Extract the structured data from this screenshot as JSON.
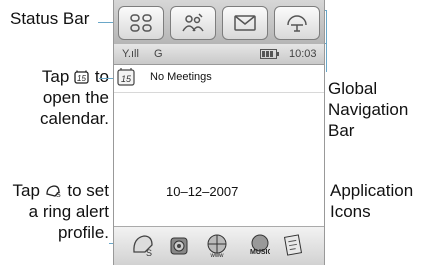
{
  "callouts": {
    "status_bar": "Status Bar",
    "calendar_hint": [
      "Tap",
      "to",
      "open the",
      "calendar."
    ],
    "global_nav": [
      "Global",
      "Navigation",
      "Bar"
    ],
    "ring_hint": [
      "Tap",
      "to set",
      "a ring alert",
      "profile."
    ],
    "app_icons": [
      "Application",
      "Icons"
    ]
  },
  "phone": {
    "nav_buttons": [
      "menu-icon",
      "contacts-icon",
      "message-icon",
      "browser-icon"
    ],
    "status": {
      "signal": "Y.ıll",
      "network": "G",
      "time": "10:03"
    },
    "meetings_text": "No Meetings",
    "date": "10–12–2007",
    "app_icons": [
      "ring-alert-icon",
      "camera-icon",
      "www-icon",
      "music-icon",
      "notes-icon"
    ]
  },
  "colors": {
    "leader": "#6aa7c8"
  }
}
